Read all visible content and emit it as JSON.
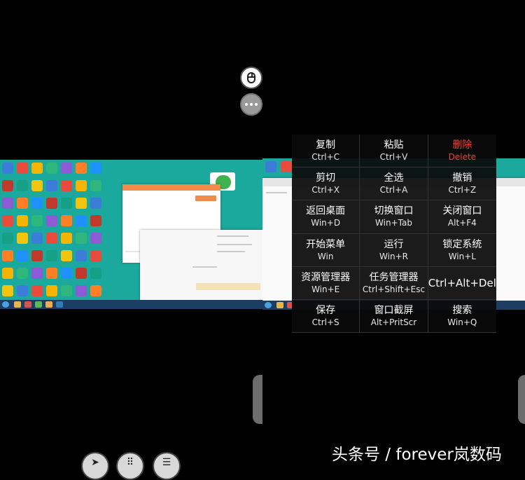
{
  "floating": {
    "mouse_icon": "mouse-icon",
    "more_icon": "more-dots-icon"
  },
  "shortcuts": [
    {
      "name": "复制",
      "key": "Ctrl+C"
    },
    {
      "name": "粘贴",
      "key": "Ctrl+V"
    },
    {
      "name": "删除",
      "key": "Delete",
      "color": "#ff3b30"
    },
    {
      "name": "剪切",
      "key": "Ctrl+X"
    },
    {
      "name": "全选",
      "key": "Ctrl+A"
    },
    {
      "name": "撤销",
      "key": "Ctrl+Z"
    },
    {
      "name": "返回桌面",
      "key": "Win+D"
    },
    {
      "name": "切换窗口",
      "key": "Win+Tab"
    },
    {
      "name": "关闭窗口",
      "key": "Alt+F4"
    },
    {
      "name": "开始菜单",
      "key": "Win"
    },
    {
      "name": "运行",
      "key": "Win+R"
    },
    {
      "name": "锁定系统",
      "key": "Win+L"
    },
    {
      "name": "资源管理器",
      "key": "Win+E"
    },
    {
      "name": "任务管理器",
      "key": "Ctrl+Shift+Esc"
    },
    {
      "name": "Ctrl+Alt+Del",
      "key": ""
    },
    {
      "name": "保存",
      "key": "Ctrl+S"
    },
    {
      "name": "窗口截屏",
      "key": "Alt+PritScr"
    },
    {
      "name": "搜索",
      "key": "Win+Q"
    }
  ],
  "toolbar": {
    "pointer_icon": "cursor-pointer-icon",
    "keyboard_icon": "keyboard-icon",
    "menu_icon": "menu-icon"
  },
  "watermark": "头条号 / forever岚数码",
  "colors": {
    "desktop": "#1aa99c",
    "accent": "#f28a4a",
    "danger": "#ff3b30",
    "taskbar": "#1c3e63"
  }
}
